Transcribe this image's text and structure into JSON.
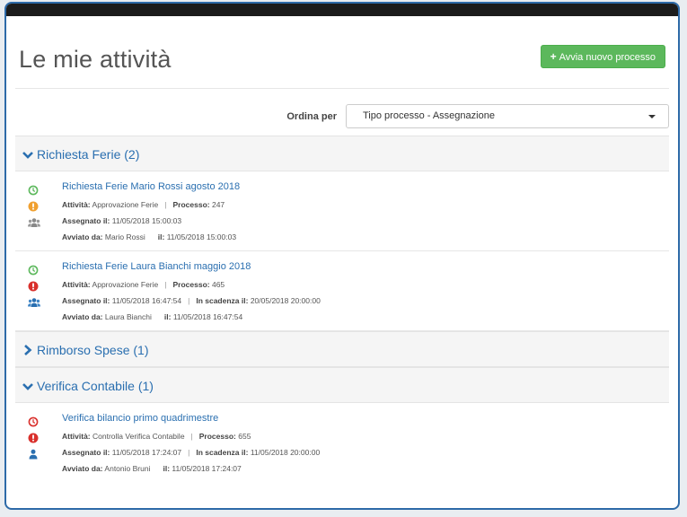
{
  "page": {
    "title": "Le mie attività",
    "new_button": "Avvia nuovo processo"
  },
  "sort": {
    "label": "Ordina per",
    "value": "Tipo processo - Assegnazione"
  },
  "groups": [
    {
      "title": "Richiesta Ferie (2)",
      "expanded": true,
      "items": [
        {
          "title": "Richiesta Ferie Mario Rossi agosto 2018",
          "status_icon": "clock-green-icon",
          "priority_icon": "warning-orange-icon",
          "assignee_icon": "group-gray-icon",
          "activity_label": "Attività:",
          "activity": "Approvazione Ferie",
          "process_label": "Processo:",
          "process": "247",
          "assigned_label": "Assegnato il:",
          "assigned": "11/05/2018 15:00:03",
          "started_by_label": "Avviato da:",
          "started_by": "Mario Rossi",
          "on_label": "il:",
          "started_on": "11/05/2018 15:00:03"
        },
        {
          "title": "Richiesta Ferie Laura Bianchi maggio 2018",
          "status_icon": "clock-green-icon",
          "priority_icon": "alert-red-icon",
          "assignee_icon": "group-blue-icon",
          "activity_label": "Attività:",
          "activity": "Approvazione Ferie",
          "process_label": "Processo:",
          "process": "465",
          "assigned_label": "Assegnato il:",
          "assigned": "11/05/2018 16:47:54",
          "due_label": "In scadenza il:",
          "due": "20/05/2018 20:00:00",
          "started_by_label": "Avviato da:",
          "started_by": "Laura Bianchi",
          "on_label": "il:",
          "started_on": "11/05/2018 16:47:54"
        }
      ]
    },
    {
      "title": "Rimborso Spese (1)",
      "expanded": false,
      "items": []
    },
    {
      "title": "Verifica Contabile (1)",
      "expanded": true,
      "items": [
        {
          "title": "Verifica bilancio primo quadrimestre",
          "status_icon": "clock-red-icon",
          "priority_icon": "alert-red-icon",
          "assignee_icon": "user-blue-icon",
          "activity_label": "Attività:",
          "activity": "Controlla Verifica Contabile",
          "process_label": "Processo:",
          "process": "655",
          "assigned_label": "Assegnato il:",
          "assigned": "11/05/2018 17:24:07",
          "due_label": "In scadenza il:",
          "due": "11/05/2018 20:00:00",
          "started_by_label": "Avviato da:",
          "started_by": "Antonio Bruni",
          "on_label": "il:",
          "started_on": "11/05/2018 17:24:07"
        }
      ]
    }
  ],
  "colors": {
    "accent": "#2a6fb0",
    "success": "#5cb85c",
    "warning": "#f0a030",
    "danger": "#d9302c"
  }
}
